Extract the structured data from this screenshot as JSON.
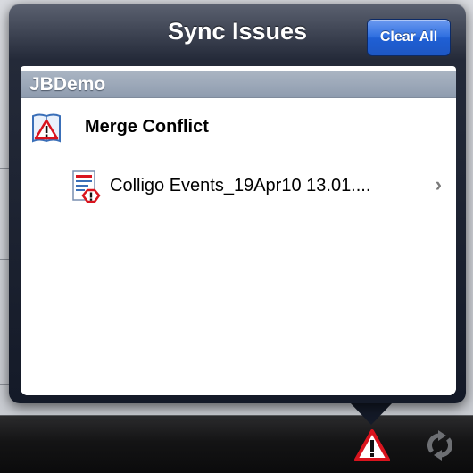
{
  "popover": {
    "title": "Sync Issues",
    "clear_all_label": "Clear All"
  },
  "table": {
    "section_title": "JBDemo",
    "group_label": "Merge Conflict",
    "items": [
      {
        "label": "Colligo Events_19Apr10 13.01....",
        "icon": "document-warning-icon"
      }
    ]
  },
  "toolbar": {
    "items": [
      {
        "icon": "warning-triangle-icon"
      },
      {
        "icon": "sync-icon"
      }
    ]
  },
  "colors": {
    "accent": "#2f6fe0",
    "warning": "#d9141e"
  }
}
